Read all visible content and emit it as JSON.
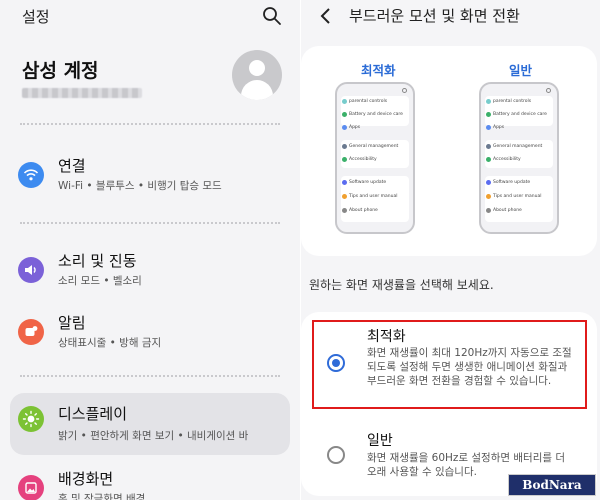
{
  "left_panel": {
    "header_title": "설정",
    "search_icon": "search-icon",
    "account_title": "삼성 계정",
    "menu": [
      {
        "title": "연결",
        "sub": "Wi-Fi • 블루투스 • 비행기 탑승 모드",
        "icon": "wifi-icon",
        "color": "#3d8bf0"
      },
      {
        "title": "소리 및 진동",
        "sub": "소리 모드 • 벨소리",
        "icon": "volume-icon",
        "color": "#7b61d8"
      },
      {
        "title": "알림",
        "sub": "상태표시줄 • 방해 금지",
        "icon": "notification-icon",
        "color": "#f06447"
      },
      {
        "title": "디스플레이",
        "sub": "밝기 • 편안하게 화면 보기 • 내비게이션 바",
        "icon": "brightness-icon",
        "color": "#7cc234",
        "active": true
      },
      {
        "title": "배경화면",
        "sub": "홈 및 잠금화면 배경",
        "icon": "wallpaper-icon",
        "color": "#e5417e"
      }
    ]
  },
  "right_panel": {
    "back_icon": "back-arrow-icon",
    "title": "부드러운 모션 및 화면 전환",
    "preview": {
      "labels": [
        "최적화",
        "일반"
      ],
      "phone_rows": [
        "parental controls",
        "Battery and device care",
        "Apps",
        "General management",
        "Accessibility",
        "Software update",
        "Tips and user manual",
        "About phone"
      ]
    },
    "description": "원하는 화면 재생률을 선택해 보세요.",
    "options": [
      {
        "title": "최적화",
        "desc": "화면 재생률이 최대 120Hz까지 자동으로 조절되도록 설정해 두면 생생한 애니메이션 화질과 부드러운 화면 전환을 경험할 수 있습니다.",
        "selected": true
      },
      {
        "title": "일반",
        "desc": "화면 재생률을 60Hz로 설정하면 배터리를 더 오래 사용할 수 있습니다.",
        "selected": false
      }
    ]
  },
  "watermark": "BodNara"
}
